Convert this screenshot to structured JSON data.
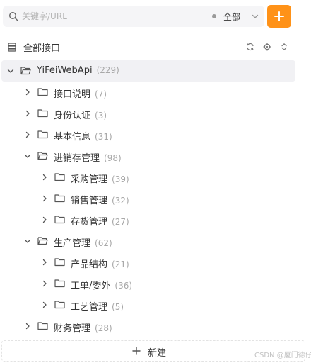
{
  "search": {
    "placeholder": "关键字/URL",
    "value": ""
  },
  "filter": {
    "selected": "全部"
  },
  "section": {
    "title": "全部接口"
  },
  "tree": {
    "root": {
      "name": "YiFeiWebApi",
      "count": "(229)"
    },
    "n1": {
      "name": "接口说明",
      "count": "(7)"
    },
    "n2": {
      "name": "身份认证",
      "count": "(3)"
    },
    "n3": {
      "name": "基本信息",
      "count": "(31)"
    },
    "n4": {
      "name": "进销存管理",
      "count": "(98)"
    },
    "n4a": {
      "name": "采购管理",
      "count": "(39)"
    },
    "n4b": {
      "name": "销售管理",
      "count": "(32)"
    },
    "n4c": {
      "name": "存货管理",
      "count": "(27)"
    },
    "n5": {
      "name": "生产管理",
      "count": "(62)"
    },
    "n5a": {
      "name": "产品结构",
      "count": "(21)"
    },
    "n5b": {
      "name": "工单/委外",
      "count": "(36)"
    },
    "n5c": {
      "name": "工艺管理",
      "count": "(5)"
    },
    "n6": {
      "name": "财务管理",
      "count": "(28)"
    }
  },
  "footer": {
    "new_label": "新建"
  },
  "watermark": "CSDN @厦门德仔",
  "colors": {
    "accent": "#ff9218",
    "selected_bg": "#f1f1f4",
    "count_text": "#a8a8a8"
  }
}
